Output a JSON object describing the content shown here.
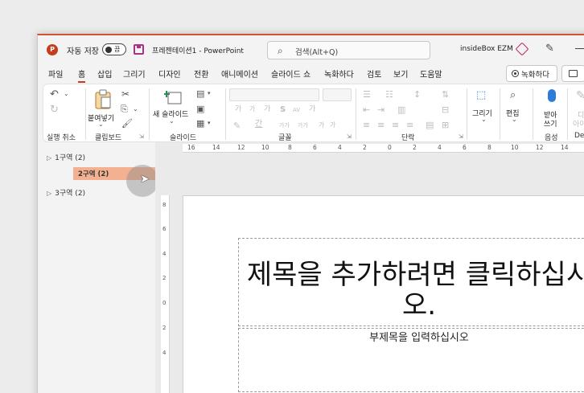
{
  "titlebar": {
    "autosave_label": "자동 저장",
    "autosave_toggle": "끔",
    "doc_title": "프레젠테이션1  -  PowerPoint",
    "search_placeholder": "검색(Alt+Q)",
    "user_name": "insideBox EZM"
  },
  "menubar": {
    "items": [
      "파일",
      "홈",
      "삽입",
      "그리기",
      "디자인",
      "전환",
      "애니메이션",
      "슬라이드 쇼",
      "녹화하다",
      "검토",
      "보기",
      "도움말"
    ],
    "active": "홈",
    "record_label": "녹화하다"
  },
  "ribbon": {
    "undo_group": "실행 취소",
    "paste_label": "붙여넣기",
    "clipboard_group": "클립보드",
    "new_slide_label": "새 슬라이드",
    "slides_group": "슬라이드",
    "font_group": "글꼴",
    "paragraph_group": "단락",
    "drawing_label": "그리기",
    "editing_label": "편집",
    "dictate_label_1": "받아",
    "dictate_label_2": "쓰기",
    "voice_group": "음성",
    "designer_label_1": "디",
    "designer_label_2": "아이",
    "designer_group": "Des"
  },
  "sections": [
    {
      "label": "1구역 (2)",
      "expanded": false
    },
    {
      "label": "2구역 (2)",
      "expanded": true,
      "selected": true
    },
    {
      "label": "3구역 (2)",
      "expanded": false
    }
  ],
  "ruler": {
    "horizontal": [
      "16",
      "14",
      "12",
      "10",
      "8",
      "6",
      "4",
      "2",
      "0",
      "2",
      "4",
      "6",
      "8",
      "10",
      "12",
      "14",
      "16"
    ],
    "vertical": [
      "8",
      "6",
      "4",
      "2",
      "0",
      "2",
      "4"
    ]
  },
  "slide": {
    "title_placeholder": "제목을 추가하려면 클릭하십시오.",
    "subtitle_placeholder": "부제목을 입력하십시오"
  },
  "colors": {
    "accent": "#c43e1c",
    "selection": "#f4b192"
  }
}
